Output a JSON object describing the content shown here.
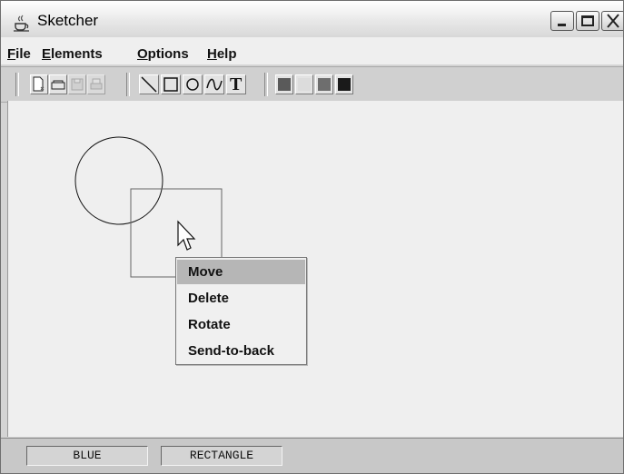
{
  "window": {
    "title": "Sketcher"
  },
  "menubar": {
    "items": [
      {
        "label_first": "F",
        "label_rest": "ile"
      },
      {
        "label_first": "E",
        "label_rest": "lements"
      },
      {
        "label_first": "O",
        "label_rest": "ptions"
      },
      {
        "label_first": "H",
        "label_rest": "elp"
      }
    ]
  },
  "toolbar": {
    "file_tools": [
      "new-file-icon",
      "open-file-icon",
      "save-icon",
      "print-icon"
    ],
    "element_tools": [
      "line-icon",
      "rectangle-icon",
      "circle-icon",
      "curve-icon",
      "text-tool-icon"
    ],
    "text_tool_glyph": "T",
    "color_swatches": [
      "#cc3333",
      "#99ee99",
      "#3355dd",
      "#444444"
    ]
  },
  "popup_menu": {
    "items": [
      "Move",
      "Delete",
      "Rotate",
      "Send-to-back"
    ],
    "selected": "Move"
  },
  "status": {
    "color": "BLUE",
    "element_type": "RECTANGLE"
  }
}
